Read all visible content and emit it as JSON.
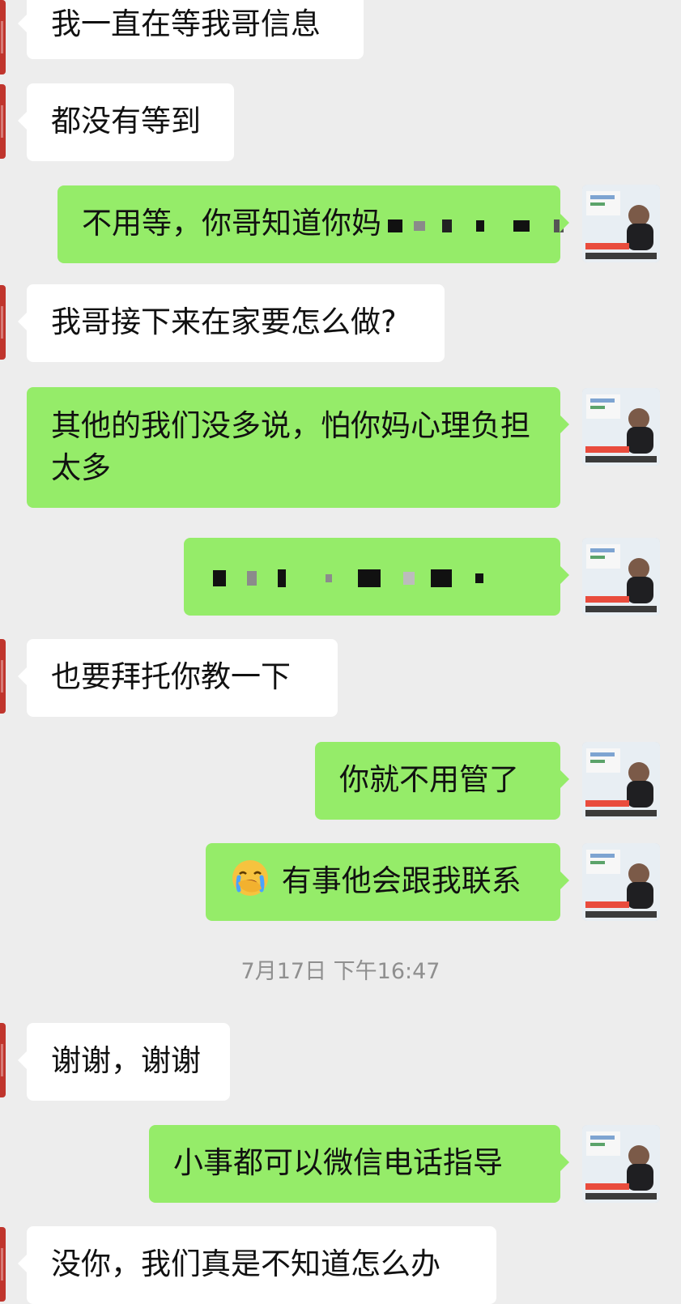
{
  "messages": [
    {
      "side": "left",
      "text": "我一直在等我哥信息"
    },
    {
      "side": "left",
      "text": "都没有等到"
    },
    {
      "side": "right",
      "text": "不用等，你哥知道你妈",
      "note": "partially obscured"
    },
    {
      "side": "left",
      "text": "我哥接下来在家要怎么做?"
    },
    {
      "side": "right",
      "text": "其他的我们没多说，怕你妈心理负担太多"
    },
    {
      "side": "right",
      "text": "",
      "note": "fully obscured"
    },
    {
      "side": "left",
      "text": "也要拜托你教一下"
    },
    {
      "side": "right",
      "text": "你就不用管了"
    },
    {
      "side": "right",
      "text": "有事他会跟我联系",
      "emoji": "face-with-hand-over-mouth-crying-emoji"
    },
    {
      "side": "left",
      "text": "谢谢，谢谢"
    },
    {
      "side": "right",
      "text": "小事都可以微信电话指导"
    },
    {
      "side": "left",
      "text": "没你，我们真是不知道怎么办"
    }
  ],
  "timestamp": "7月17日 下午16:47",
  "colors": {
    "background": "#ededed",
    "left_bubble": "#ffffff",
    "right_bubble": "#95ec69",
    "left_avatar_stub": "#c0352d"
  },
  "icons": {
    "avatar": "user-avatar-icon"
  }
}
